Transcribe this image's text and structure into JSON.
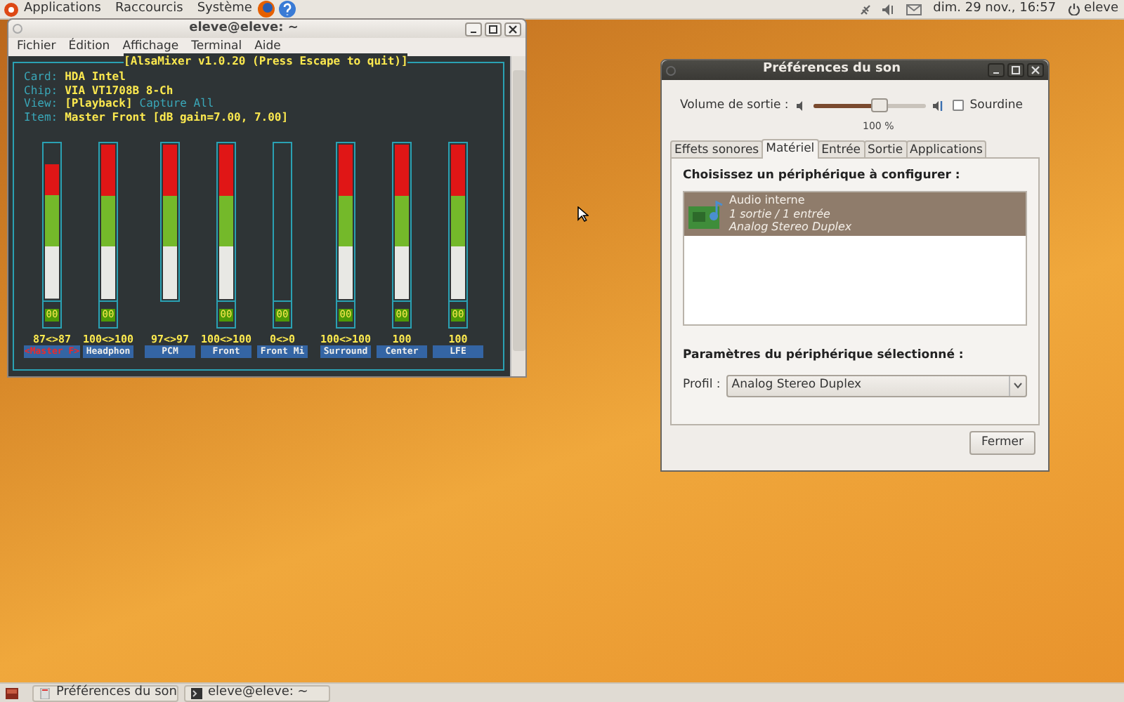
{
  "top_panel": {
    "menus": [
      "Applications",
      "Raccourcis",
      "Système"
    ],
    "clock": "dim. 29 nov., 16:57",
    "user": "eleve"
  },
  "terminal": {
    "title": "eleve@eleve: ~",
    "menu": [
      "Fichier",
      "Édition",
      "Affichage",
      "Terminal",
      "Aide"
    ],
    "alsamixer": {
      "header": "[AlsaMixer v1.0.20 (Press Escape to quit)]",
      "info": [
        {
          "key": "Card:",
          "value": "HDA Intel"
        },
        {
          "key": "Chip:",
          "value": "VIA VT1708B 8-Ch"
        },
        {
          "key": "View:",
          "value": "[Playback]",
          "extra": "Capture  All"
        },
        {
          "key": "Item:",
          "value": "Master Front [dB gain=7.00, 7.00]"
        }
      ],
      "channels": [
        {
          "name": "<Master F>",
          "value": "87<>87",
          "level": 0.87,
          "mute": "00",
          "selected": true
        },
        {
          "name": "Headphon",
          "value": "100<>100",
          "level": 1,
          "mute": "00",
          "selected": false
        },
        {
          "name": "PCM",
          "value": "97<>97",
          "level": 1,
          "selected": false
        },
        {
          "name": "Front",
          "value": "100<>100",
          "level": 1,
          "mute": "00",
          "selected": false
        },
        {
          "name": "Front Mi",
          "value": "0<>0",
          "level": 0,
          "mute": "00",
          "selected": false
        },
        {
          "name": "Surround",
          "value": "100<>100",
          "level": 1,
          "mute": "00",
          "selected": false
        },
        {
          "name": "Center",
          "value": "100",
          "level": 1,
          "mute": "00",
          "selected": false
        },
        {
          "name": "LFE",
          "value": "100",
          "level": 1,
          "mute": "00",
          "selected": false
        }
      ]
    }
  },
  "sound_prefs": {
    "title": "Préférences du son",
    "volume_label": "Volume de sortie :",
    "volume": {
      "level": 0.58
    },
    "volume_reading": "100 %",
    "mute": {
      "label": "Sourdine",
      "checked": false
    },
    "tabs": [
      {
        "label": "Effets sonores",
        "selected": false
      },
      {
        "label": "Matériel",
        "selected": true
      },
      {
        "label": "Entrée",
        "selected": false
      },
      {
        "label": "Sortie",
        "selected": false
      },
      {
        "label": "Applications",
        "selected": false
      }
    ],
    "device_heading": "Choisissez un périphérique à configurer :",
    "devices": [
      {
        "name": "Audio interne",
        "detail": "1 sortie / 1 entrée",
        "profile": "Analog Stereo Duplex",
        "selected": true
      }
    ],
    "settings_heading": "Paramètres du périphérique sélectionné :",
    "profile_label": "Profil :",
    "profile_value": "Analog Stereo Duplex",
    "close_button": "Fermer"
  },
  "taskbar": [
    {
      "label": "Préférences du son",
      "kind": "prefs",
      "selected": false
    },
    {
      "label": "eleve@eleve: ~",
      "kind": "terminal",
      "selected": false
    }
  ]
}
